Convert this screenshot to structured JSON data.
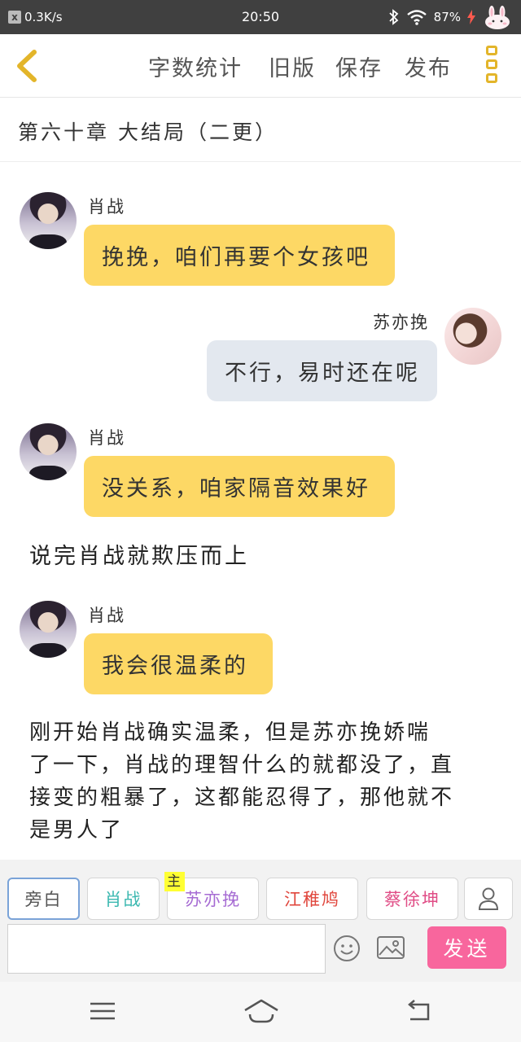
{
  "status_bar": {
    "speed": "0.3K/s",
    "time": "20:50",
    "battery": "87%",
    "x_icon_label": "x"
  },
  "toolbar": {
    "word_count": "字数统计",
    "old_version": "旧版",
    "save": "保存",
    "publish": "发布"
  },
  "chapter": {
    "title": "第六十章 大结局（二更）"
  },
  "messages": [
    {
      "speaker": "肖战",
      "text": "挽挽，咱们再要个女孩吧",
      "side": "left",
      "color": "#fdd865"
    },
    {
      "speaker": "苏亦挽",
      "text": "不行，易时还在呢",
      "side": "right",
      "color": "#e3e8ef"
    },
    {
      "speaker": "肖战",
      "text": "没关系，咱家隔音效果好",
      "side": "left",
      "color": "#fdd865"
    },
    {
      "speaker": "肖战",
      "text": "我会很温柔的",
      "side": "left",
      "color": "#fdd865"
    }
  ],
  "narrations": [
    {
      "lines": [
        "说完肖战就欺压而上"
      ]
    },
    {
      "lines": [
        "刚开始肖战确实温柔，但是苏亦挽娇喘",
        "了一下，肖战的理智什么的就都没了，直",
        "接变的粗暴了，这都能忍得了，那他就不",
        "是男人了"
      ]
    }
  ],
  "characters": [
    {
      "label": "旁白",
      "color": "#555555",
      "active": true
    },
    {
      "label": "肖战",
      "color": "#3bb8b0"
    },
    {
      "label": "苏亦挽",
      "color": "#a66bd3",
      "tag": "主"
    },
    {
      "label": "江稚鸠",
      "color": "#e0463c"
    },
    {
      "label": "蔡徐坤",
      "color": "#e04d86"
    }
  ],
  "input": {
    "value": "",
    "send": "发送"
  },
  "accent": {
    "yellow": "#fdd865",
    "pink": "#f8669d",
    "gold_icon": "#e3b52a"
  },
  "icons": {
    "back": "chevron-left-icon",
    "menu": "more-vertical-icon",
    "emoji": "smiley-icon",
    "image": "image-icon",
    "add_character": "person-icon",
    "nav": [
      "menu-icon",
      "home-icon",
      "back-icon"
    ]
  }
}
